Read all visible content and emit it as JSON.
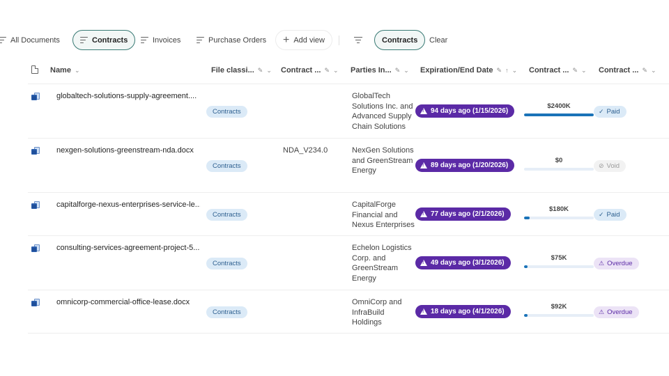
{
  "view_tabs": [
    {
      "label": "All Documents"
    },
    {
      "label": "Contracts"
    },
    {
      "label": "Invoices"
    },
    {
      "label": "Purchase Orders"
    },
    {
      "label": "Add view"
    }
  ],
  "filter": {
    "active_label": "Contracts",
    "clear_label": "Clear"
  },
  "columns": {
    "name": "Name",
    "file_classification": "File classi...",
    "contract_id": "Contract ...",
    "parties": "Parties In...",
    "expiration": "Expiration/End Date",
    "contract_amount": "Contract ...",
    "contract_status": "Contract ..."
  },
  "rows": [
    {
      "name": "globaltech-solutions-supply-agreement....",
      "classification": "Contracts",
      "contract_id": "",
      "parties": "GlobalTech Solutions Inc. and Advanced Supply Chain Solutions",
      "expiration": "94 days ago (1/15/2026)",
      "amount": "$2400K",
      "amount_fill": 1.0,
      "status": "Paid",
      "status_kind": "paid"
    },
    {
      "name": "nexgen-solutions-greenstream-nda.docx",
      "classification": "Contracts",
      "contract_id": "NDA_V234.0",
      "parties": "NexGen Solutions and GreenStream Energy",
      "expiration": "89 days ago (1/20/2026)",
      "amount": "$0",
      "amount_fill": 0.0,
      "status": "Void",
      "status_kind": "void"
    },
    {
      "name": "capitalforge-nexus-enterprises-service-le...",
      "classification": "Contracts",
      "contract_id": "",
      "parties": "CapitalForge Financial and Nexus Enterprises",
      "expiration": "77 days ago (2/1/2026)",
      "amount": "$180K",
      "amount_fill": 0.075,
      "status": "Paid",
      "status_kind": "paid"
    },
    {
      "name": "consulting-services-agreement-project-5...",
      "classification": "Contracts",
      "contract_id": "",
      "parties": "Echelon Logistics Corp. and GreenStream Energy",
      "expiration": "49 days ago (3/1/2026)",
      "amount": "$75K",
      "amount_fill": 0.031,
      "status": "Overdue",
      "status_kind": "overdue"
    },
    {
      "name": "omnicorp-commercial-office-lease.docx",
      "classification": "Contracts",
      "contract_id": "",
      "parties": "OmniCorp and InfraBuild Holdings",
      "expiration": "18 days ago (4/1/2026)",
      "amount": "$92K",
      "amount_fill": 0.038,
      "status": "Overdue",
      "status_kind": "overdue"
    }
  ],
  "colors": {
    "accent": "#3a7b75",
    "expiration_badge": "#5b2aa6",
    "bar_fill": "#1a73b8"
  }
}
